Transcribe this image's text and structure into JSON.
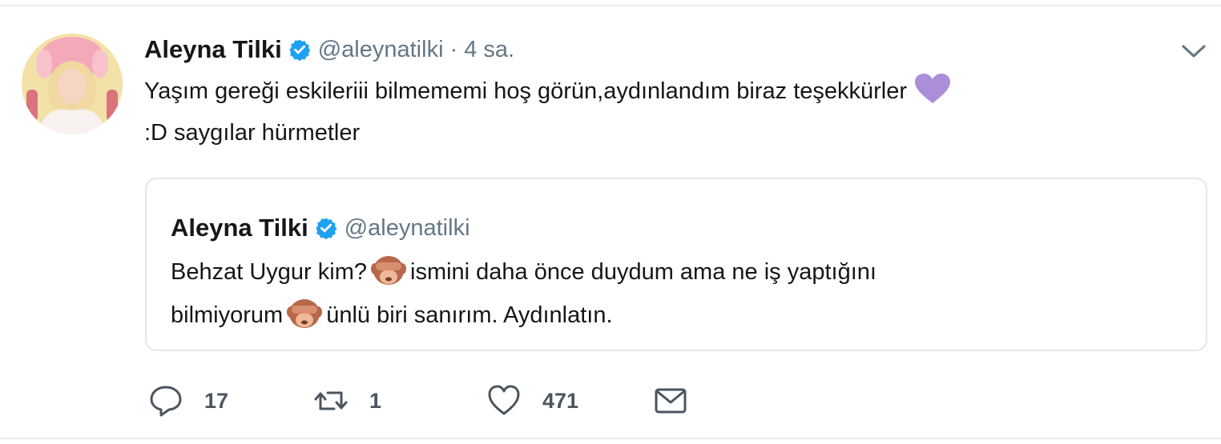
{
  "tweet": {
    "author_name": "Aleyna Tilki",
    "handle": "@aleynatilki",
    "separator": "·",
    "time": "4 sa.",
    "text_main": "Yaşım gereği eskileriii bilmememi hoş görün,aydınlandım biraz teşekkürler",
    "text_tail": ":D saygılar hürmetler"
  },
  "quoted": {
    "author_name": "Aleyna Tilki",
    "handle": "@aleynatilki",
    "text_1": "Behzat Uygur kim?",
    "text_2": "ismini daha önce duydum ama ne iş yaptığını",
    "text_3": "bilmiyorum",
    "text_4": "ünlü biri sanırım. Aydınlatın."
  },
  "actions": {
    "replies": "17",
    "retweets": "1",
    "likes": "471"
  },
  "icons": {
    "verified": "verified-badge-icon",
    "menu": "chevron-down-icon",
    "heart_emoji": "purple-heart-icon",
    "monkey_emoji": "see-no-evil-monkey-icon",
    "reply": "reply-icon",
    "retweet": "retweet-icon",
    "like": "heart-icon",
    "dm": "envelope-icon"
  },
  "colors": {
    "verified_blue": "#1da1f2",
    "secondary_text": "#657786",
    "border": "#e1e8ed",
    "purple_heart": "#ab8ed8"
  }
}
